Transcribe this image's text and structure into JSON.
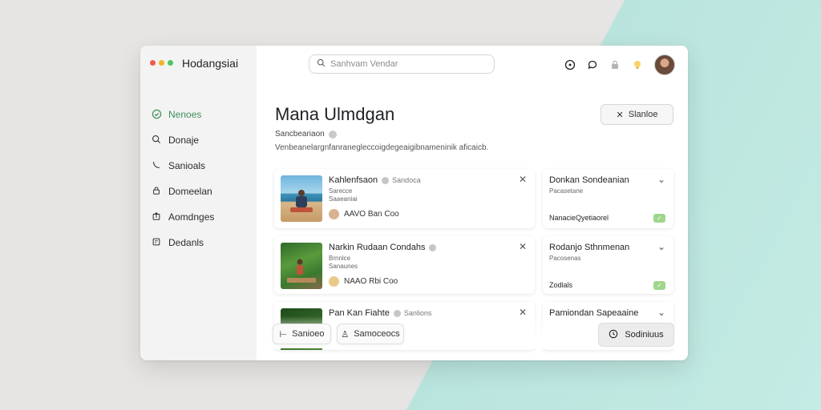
{
  "app": {
    "title": "Hodangsiai"
  },
  "colors": {
    "accent": "#3e8f5a",
    "toggle": "#9fd68c",
    "red": "#ef5a4f",
    "yellow": "#f2b32c",
    "green": "#4fc463"
  },
  "search": {
    "placeholder": "Sanhvam Vendar"
  },
  "sidebar": {
    "items": [
      {
        "label": "Nenoes",
        "icon": "check-circle-icon",
        "active": true
      },
      {
        "label": "Donaje",
        "icon": "search-icon"
      },
      {
        "label": "Sanioals",
        "icon": "phone-icon"
      },
      {
        "label": "Domeelan",
        "icon": "lock-icon"
      },
      {
        "label": "Aomdnges",
        "icon": "upload-icon"
      },
      {
        "label": "Dedanls",
        "icon": "box-icon"
      }
    ]
  },
  "header": {
    "title": "Mana Ulmdgan",
    "subtitle": "Sancbeariaon",
    "description": "Venbeanelargnfanranegleccoigdegeaigibnameninik aficaicb.",
    "action_label": "Slanloe"
  },
  "cards": [
    {
      "title": "Kahlenfsaon",
      "tag": "Sandoca",
      "line1": "Sarecce",
      "line2": "Saaeaniai",
      "meta": "AAVO Ban Coo",
      "thumb": "beach"
    },
    {
      "title": "Narkin Rudaan Condahs",
      "tag": "",
      "line1": "Brnnlce",
      "line2": "Sanaunes",
      "meta": "NAAO Rbi Coo",
      "thumb": "jungle"
    },
    {
      "title": "Pan Kan Fiahte",
      "tag": "Sanlions",
      "line1": "",
      "line2": "",
      "meta": "",
      "thumb": "leaves"
    }
  ],
  "right_cards": [
    {
      "title": "Donkan Sondeanian",
      "sub": "Pacasetane",
      "label": "NanacieQyetiaorel"
    },
    {
      "title": "Rodanjo Sthnmenan",
      "sub": "Pacosenas",
      "label": "Zodlals"
    },
    {
      "title": "Pamiondan Sapeaaine",
      "sub": "",
      "label": ""
    }
  ],
  "footer": {
    "btn1": "Sanioeo",
    "btn2": "Samoceocs",
    "primary": "Sodiniuus"
  }
}
